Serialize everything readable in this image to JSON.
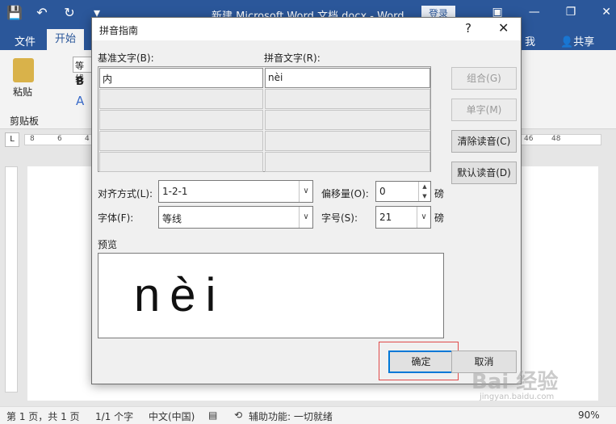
{
  "window": {
    "title": "新建 Microsoft Word 文档.docx  -  Word",
    "login": "登录"
  },
  "ribbon_tabs": {
    "file": "文件",
    "home": "开始",
    "find": "我",
    "share": "共享"
  },
  "ribbon": {
    "paste": "粘贴",
    "clipboard": "剪贴板",
    "font_name": "等线",
    "bold": "B",
    "font_color": "A"
  },
  "ruler": {
    "h_ticks": [
      "8",
      "6",
      "4",
      "2",
      "",
      "",
      "",
      "",
      "",
      "",
      "",
      "",
      "",
      "",
      "",
      "C",
      "42",
      "44",
      "46",
      "48"
    ]
  },
  "dialog": {
    "title": "拼音指南",
    "help": "?",
    "base_text_label": "基准文字(B):",
    "pinyin_text_label": "拼音文字(R):",
    "rows": [
      {
        "base": "内",
        "pinyin": "nèi"
      },
      {
        "base": "",
        "pinyin": ""
      },
      {
        "base": "",
        "pinyin": ""
      },
      {
        "base": "",
        "pinyin": ""
      },
      {
        "base": "",
        "pinyin": ""
      }
    ],
    "buttons": {
      "group": "组合(G)",
      "single": "单字(M)",
      "clear": "清除读音(C)",
      "default": "默认读音(D)",
      "ok": "确定",
      "cancel": "取消"
    },
    "align_label": "对齐方式(L):",
    "align_value": "1-2-1",
    "offset_label": "偏移量(O):",
    "offset_value": "0",
    "offset_unit": "磅",
    "font_label": "字体(F):",
    "font_value": "等线",
    "size_label": "字号(S):",
    "size_value": "21",
    "size_unit": "磅",
    "preview_label": "预览",
    "preview_text": "nèi"
  },
  "status": {
    "page": "第 1 页，共 1 页",
    "words": "1/1 个字",
    "lang": "中文(中国)",
    "accessibility": "辅助功能: 一切就绪",
    "zoom": "90%"
  },
  "watermark": {
    "main": "Bai 经验",
    "sub": "jingyan.baidu.com"
  }
}
